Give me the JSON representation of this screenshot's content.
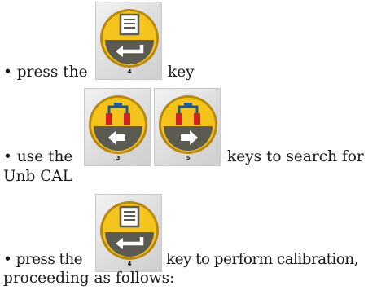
{
  "colors": {
    "button_yellow": "#f4c41d",
    "button_dark": "#5b5b52",
    "icon_red": "#d2231b",
    "icon_blue": "#1f5a8e",
    "text": "#1a1a1a"
  },
  "steps": [
    {
      "prefix": "• press the",
      "suffix": "key",
      "keys": [
        {
          "number": "4",
          "icon": "enter-icon"
        }
      ]
    },
    {
      "prefix": "• use the",
      "suffix": "keys to search for",
      "continuation": "Unb CAL",
      "keys": [
        {
          "number": "3",
          "icon": "search-left-icon"
        },
        {
          "number": "5",
          "icon": "search-right-icon"
        }
      ]
    },
    {
      "prefix": "• press the",
      "suffix": "key to perform calibration,",
      "continuation": "proceeding as follows:",
      "keys": [
        {
          "number": "4",
          "icon": "enter-icon"
        }
      ]
    }
  ]
}
